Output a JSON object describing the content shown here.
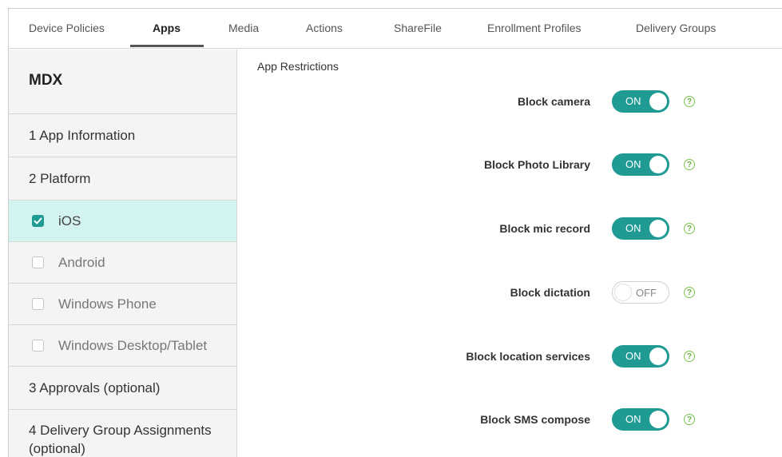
{
  "tabs": [
    {
      "label": "Device Policies",
      "active": false
    },
    {
      "label": "Apps",
      "active": true
    },
    {
      "label": "Media",
      "active": false
    },
    {
      "label": "Actions",
      "active": false
    },
    {
      "label": "ShareFile",
      "active": false
    },
    {
      "label": "Enrollment Profiles",
      "active": false
    },
    {
      "label": "Delivery Groups",
      "active": false
    }
  ],
  "sidebar": {
    "title": "MDX",
    "steps": {
      "app_info": "1  App Information",
      "platform": "2  Platform",
      "approvals": "3  Approvals (optional)",
      "delivery": "4  Delivery Group Assignments (optional)"
    },
    "platforms": [
      {
        "label": "iOS",
        "checked": true
      },
      {
        "label": "Android",
        "checked": false
      },
      {
        "label": "Windows Phone",
        "checked": false
      },
      {
        "label": "Windows Desktop/Tablet",
        "checked": false
      }
    ]
  },
  "main": {
    "section_title": "App Restrictions",
    "help_glyph": "?",
    "restrictions": [
      {
        "label": "Block camera",
        "state": "ON"
      },
      {
        "label": "Block Photo Library",
        "state": "ON"
      },
      {
        "label": "Block mic record",
        "state": "ON"
      },
      {
        "label": "Block dictation",
        "state": "OFF"
      },
      {
        "label": "Block location services",
        "state": "ON"
      },
      {
        "label": "Block SMS compose",
        "state": "ON"
      }
    ]
  },
  "colors": {
    "accent": "#1f9b93",
    "selected_row": "#d3f3f0",
    "help": "#6ab33e"
  }
}
